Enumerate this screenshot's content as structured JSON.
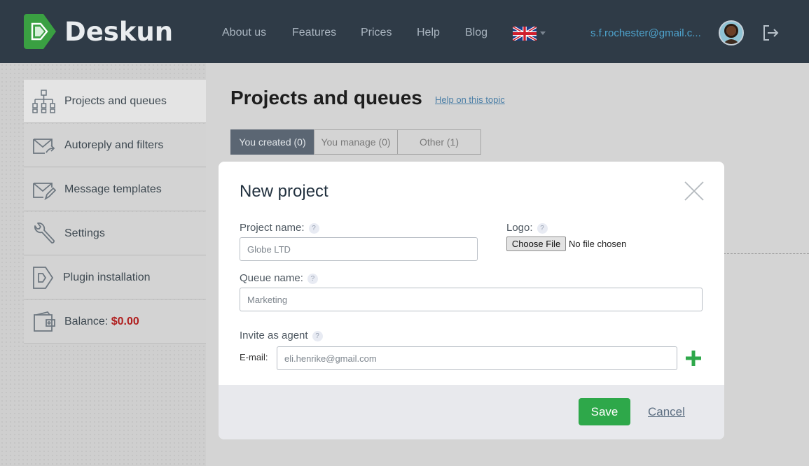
{
  "header": {
    "logo_text": "Deskun",
    "nav": [
      "About us",
      "Features",
      "Prices",
      "Help",
      "Blog"
    ],
    "language": "flag-uk-icon",
    "user_email": "s.f.rochester@gmail.c...",
    "brand_color": "#3aa042"
  },
  "sidebar": {
    "items": [
      {
        "label": "Projects and queues",
        "icon": "hierarchy-icon"
      },
      {
        "label": "Autoreply and filters",
        "icon": "mail-forward-icon"
      },
      {
        "label": "Message templates",
        "icon": "mail-edit-icon"
      },
      {
        "label": "Settings",
        "icon": "wrench-icon"
      },
      {
        "label": "Plugin installation",
        "icon": "plugin-icon"
      }
    ],
    "balance": {
      "label": "Balance:",
      "value": "$0.00",
      "icon": "wallet-icon"
    }
  },
  "main": {
    "title": "Projects and queues",
    "help_link": "Help on this topic",
    "tabs": [
      "You created (0)",
      "You manage (0)",
      "Other (1)"
    ]
  },
  "modal": {
    "title": "New project",
    "project_name_label": "Project name:",
    "project_name_placeholder": "Globe LTD",
    "logo_label": "Logo:",
    "file_button": "Choose File",
    "file_status": "No file chosen",
    "queue_name_label": "Queue name:",
    "queue_name_placeholder": "Marketing",
    "invite_label": "Invite as agent",
    "email_label": "E-mail:",
    "email_placeholder": "eli.henrike@gmail.com",
    "help_badge": "?",
    "save_label": "Save",
    "cancel_label": "Cancel"
  }
}
